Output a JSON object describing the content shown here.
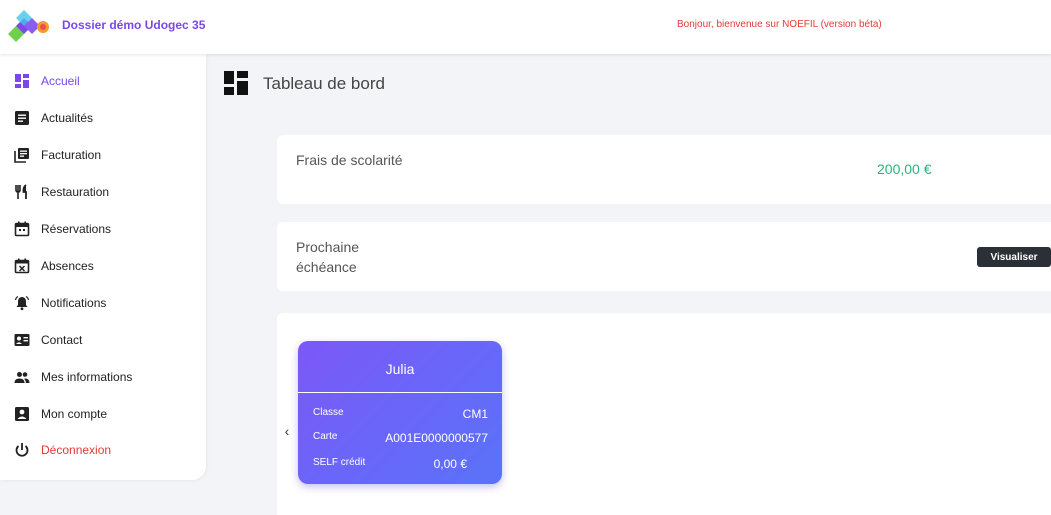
{
  "header": {
    "org_name": "Dossier démo Udogec 35",
    "welcome": "Bonjour, bienvenue sur NOEFIL (version béta)"
  },
  "sidebar": {
    "items": [
      {
        "label": "Accueil",
        "icon": "dashboard-icon",
        "active": true
      },
      {
        "label": "Actualités",
        "icon": "news-icon"
      },
      {
        "label": "Facturation",
        "icon": "invoice-icon"
      },
      {
        "label": "Restauration",
        "icon": "restaurant-icon"
      },
      {
        "label": "Réservations",
        "icon": "calendar-icon"
      },
      {
        "label": "Absences",
        "icon": "calendar-x-icon"
      },
      {
        "label": "Notifications",
        "icon": "bell-icon"
      },
      {
        "label": "Contact",
        "icon": "contact-card-icon"
      },
      {
        "label": "Mes informations",
        "icon": "people-icon"
      },
      {
        "label": "Mon compte",
        "icon": "account-box-icon"
      },
      {
        "label": "Déconnexion",
        "icon": "power-icon"
      }
    ]
  },
  "page": {
    "title": "Tableau de bord"
  },
  "cards": {
    "fees": {
      "label": "Frais de scolarité",
      "amount": "200,00 €"
    },
    "next_due": {
      "label": "Prochaine échéance",
      "button": "Visualiser"
    }
  },
  "student": {
    "name": "Julia",
    "rows": [
      {
        "label": "Classe",
        "value": "CM1"
      },
      {
        "label": "Carte",
        "value": "A001E0000000577"
      },
      {
        "label": "SELF crédit",
        "value": "0,00 €"
      }
    ]
  },
  "colors": {
    "accent": "#7b47e6",
    "danger": "#e53935",
    "success": "#2db37a",
    "dark_button": "#2b2f36"
  }
}
